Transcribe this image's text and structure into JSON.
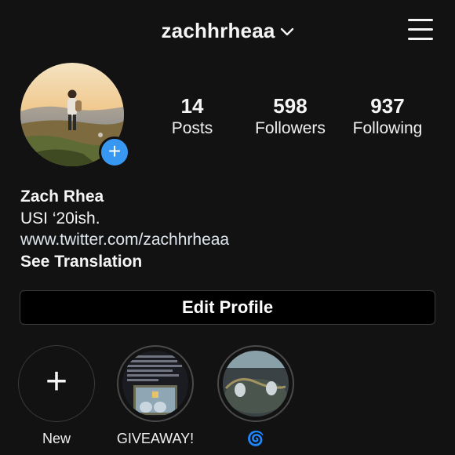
{
  "header": {
    "username": "zachhrheaa",
    "dropdown_icon": "chevron-down-icon",
    "menu_icon": "hamburger-menu-icon"
  },
  "profile": {
    "add_story_icon": "plus-icon",
    "stats": [
      {
        "value": "14",
        "label": "Posts"
      },
      {
        "value": "598",
        "label": "Followers"
      },
      {
        "value": "937",
        "label": "Following"
      }
    ]
  },
  "bio": {
    "name": "Zach Rhea",
    "line": "USI ‘20ish.",
    "link": "www.twitter.com/zachhrheaa",
    "translate": "See Translation"
  },
  "actions": {
    "edit_profile": "Edit Profile"
  },
  "highlights": [
    {
      "label": "New",
      "icon": "plus-icon"
    },
    {
      "label": "GIVEAWAY!"
    },
    {
      "label": "🌀"
    }
  ],
  "colors": {
    "background": "#121212",
    "accent": "#3897f0",
    "border": "#3a3a3a"
  }
}
